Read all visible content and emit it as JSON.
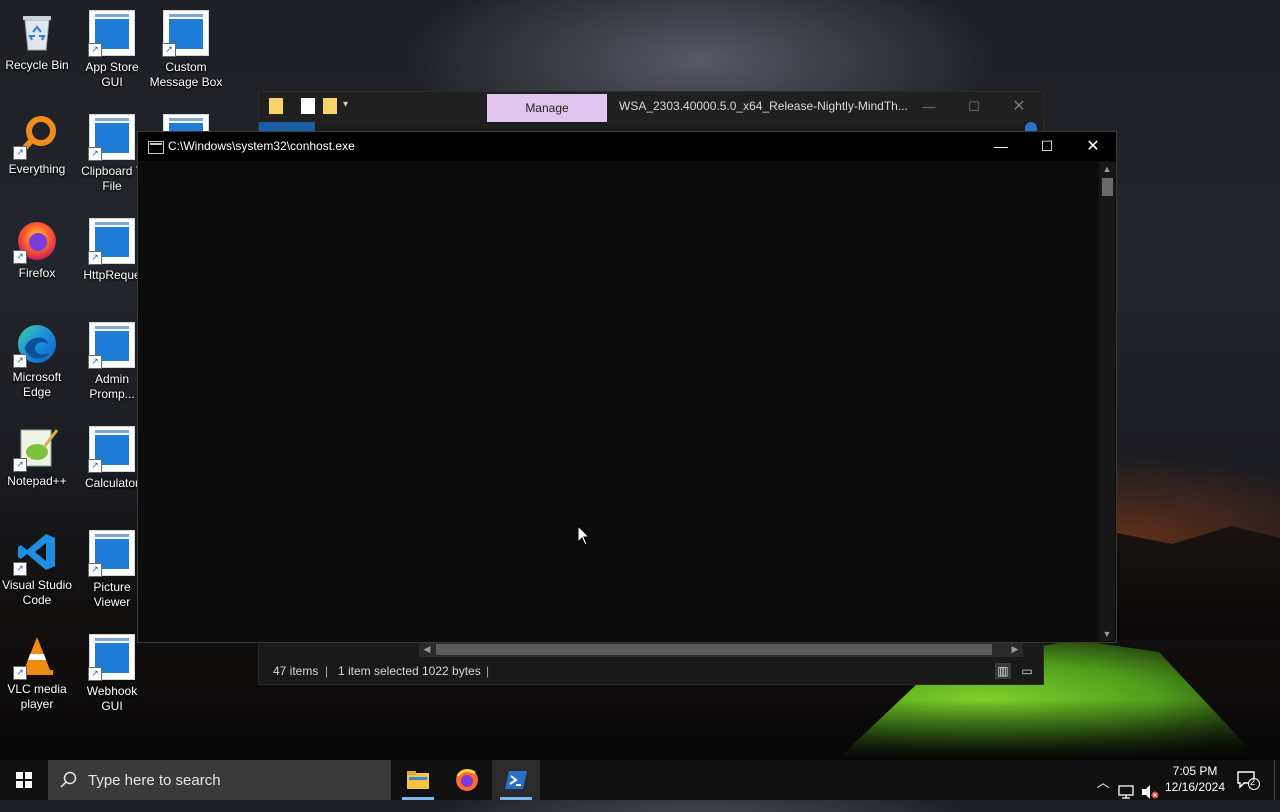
{
  "desktop": {
    "icons": [
      {
        "label": "Recycle Bin",
        "icon": "recycle-bin-icon"
      },
      {
        "label": "App Store GUI",
        "icon": "app-window-icon"
      },
      {
        "label": "Custom Message Box",
        "icon": "app-window-icon"
      },
      {
        "label": "Everything",
        "icon": "search-magnifier-icon"
      },
      {
        "label": "Clipboard T File",
        "icon": "app-window-icon"
      },
      {
        "label": "Firefox",
        "icon": "firefox-icon"
      },
      {
        "label": "HttpReque",
        "icon": "app-window-icon"
      },
      {
        "label": "Microsoft Edge",
        "icon": "edge-icon"
      },
      {
        "label": "Admin Promp...",
        "icon": "app-window-icon"
      },
      {
        "label": "Notepad++",
        "icon": "notepadpp-icon"
      },
      {
        "label": "Calculator",
        "icon": "app-window-icon"
      },
      {
        "label": "Visual Studio Code",
        "icon": "vscode-icon"
      },
      {
        "label": "Picture Viewer",
        "icon": "app-window-icon"
      },
      {
        "label": "VLC media player",
        "icon": "vlc-icon"
      },
      {
        "label": "Webhook GUI",
        "icon": "app-window-icon"
      }
    ]
  },
  "explorer": {
    "manage_tab": "Manage",
    "title": "WSA_2303.40000.5.0_x64_Release-Nightly-MindTh...",
    "status": {
      "items": "47 items",
      "selected": "1 item selected",
      "size": "1022 bytes"
    }
  },
  "console": {
    "title": "C:\\Windows\\system32\\conhost.exe"
  },
  "taskbar": {
    "search_placeholder": "Type here to search",
    "time": "7:05 PM",
    "date": "12/16/2024",
    "notification_count": "2"
  },
  "colors": {
    "taskbar_accent": "#76b9ed",
    "manage_tab_bg": "#e2c5ee",
    "console_bg": "#0c0c0c"
  }
}
